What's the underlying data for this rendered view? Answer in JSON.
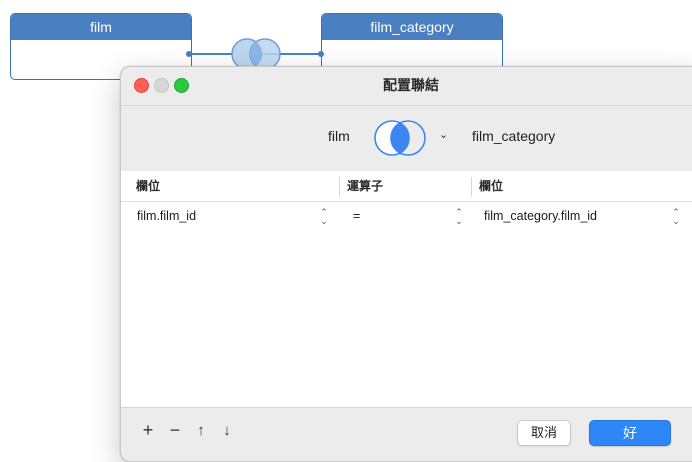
{
  "canvas": {
    "left_table": {
      "name": "film"
    },
    "right_table": {
      "name": "film_category"
    }
  },
  "dialog": {
    "title": "配置聯結",
    "window_controls": [
      "close",
      "minimize",
      "zoom"
    ],
    "join": {
      "left_table": "film",
      "right_table": "film_category",
      "join_type_icon": "venn-inner-join-icon",
      "dropdown_icon": "chevron-down-icon"
    },
    "columns": {
      "left_field": "欄位",
      "operator": "運算子",
      "right_field": "欄位"
    },
    "rows": [
      {
        "left_field": "film.film_id",
        "operator": "=",
        "right_field": "film_category.film_id"
      }
    ],
    "toolbar": {
      "add": "+",
      "remove": "−",
      "move_up": "↑",
      "move_down": "↓"
    },
    "buttons": {
      "cancel": "取消",
      "ok": "好"
    },
    "colors": {
      "accent": "#2d87f7",
      "table_header": "#4a7fc1",
      "close": "#fe5f57",
      "zoom": "#2ac940"
    }
  }
}
